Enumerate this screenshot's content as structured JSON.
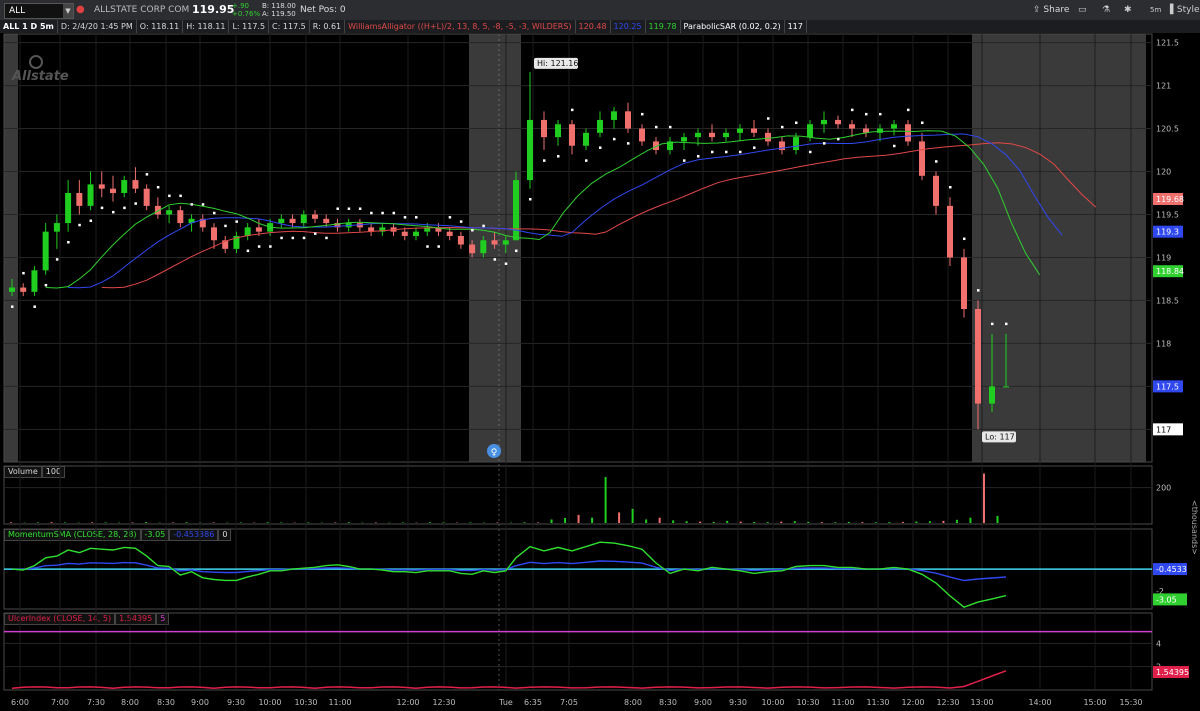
{
  "topbar": {
    "symbol": "ALL",
    "company": "ALLSTATE CORP COM",
    "last": "119.95",
    "change": "+.90",
    "change_pct": "+0.76%",
    "bid": "B: 118.00",
    "ask": "A: 119.50",
    "net_pos": "Net Pos: 0",
    "share_label": "Share",
    "aggregation_label": "5m",
    "style_label": "Style"
  },
  "header": {
    "agg": "ALL 1 D 5m",
    "date": "D: 2/4/20 1:45 PM",
    "open": "O: 118.11",
    "high": "H: 118.11",
    "low": "L: 117.5",
    "close": "C: 117.5",
    "range": "R: 0.61",
    "alligator": "WilliamsAlligator ((H+L)/2, 13, 8, 5, -8, -5, -3, WILDERS)",
    "alligator_jaw": "120.48",
    "alligator_teeth": "120.25",
    "alligator_lips": "119.78",
    "sar": "ParabolicSAR (0.02, 0.2)",
    "sar_value": "117"
  },
  "watermark": "Allstate",
  "colors": {
    "up": "#1fce1f",
    "down": "#f0706e",
    "accent": "#4a90e2",
    "jaw": "#e04848",
    "teeth": "#3048f0",
    "lips": "#30d030",
    "volume_up": "#1fce1f",
    "volume_down": "#f0706e",
    "momentum": "#30e030",
    "momentum_sma": "#3048f0",
    "zero_line": "#40d8f0",
    "ulcer": "#e0204a",
    "ulcer_threshold": "#d040d0"
  },
  "chart_data": [
    {
      "type": "candlestick",
      "panel": "price",
      "ylim": [
        116.62,
        121.6
      ],
      "y_ticks": [
        "121.5",
        "121",
        "120.5",
        "120",
        "119.5",
        "119",
        "118.5",
        "118",
        "117.5",
        "117"
      ],
      "ohlc": [
        [
          118.6,
          118.75,
          118.55,
          118.65
        ],
        [
          118.65,
          118.7,
          118.55,
          118.6
        ],
        [
          118.6,
          118.9,
          118.55,
          118.85
        ],
        [
          118.85,
          119.4,
          118.8,
          119.3
        ],
        [
          119.3,
          119.5,
          119.1,
          119.4
        ],
        [
          119.4,
          119.9,
          119.3,
          119.75
        ],
        [
          119.75,
          119.9,
          119.5,
          119.6
        ],
        [
          119.6,
          120.0,
          119.55,
          119.85
        ],
        [
          119.85,
          120.0,
          119.7,
          119.8
        ],
        [
          119.8,
          119.95,
          119.65,
          119.75
        ],
        [
          119.75,
          119.95,
          119.7,
          119.9
        ],
        [
          119.9,
          120.05,
          119.75,
          119.8
        ],
        [
          119.8,
          119.85,
          119.55,
          119.6
        ],
        [
          119.6,
          119.7,
          119.45,
          119.5
        ],
        [
          119.5,
          119.6,
          119.4,
          119.55
        ],
        [
          119.55,
          119.6,
          119.35,
          119.4
        ],
        [
          119.4,
          119.5,
          119.3,
          119.45
        ],
        [
          119.45,
          119.5,
          119.3,
          119.35
        ],
        [
          119.35,
          119.4,
          119.1,
          119.2
        ],
        [
          119.2,
          119.25,
          119.05,
          119.1
        ],
        [
          119.1,
          119.3,
          119.05,
          119.25
        ],
        [
          119.25,
          119.4,
          119.2,
          119.35
        ],
        [
          119.35,
          119.45,
          119.25,
          119.3
        ],
        [
          119.3,
          119.45,
          119.25,
          119.4
        ],
        [
          119.4,
          119.5,
          119.35,
          119.45
        ],
        [
          119.45,
          119.5,
          119.35,
          119.4
        ],
        [
          119.4,
          119.55,
          119.35,
          119.5
        ],
        [
          119.5,
          119.55,
          119.4,
          119.45
        ],
        [
          119.45,
          119.5,
          119.35,
          119.4
        ],
        [
          119.4,
          119.45,
          119.3,
          119.35
        ],
        [
          119.35,
          119.45,
          119.3,
          119.4
        ],
        [
          119.4,
          119.45,
          119.3,
          119.35
        ],
        [
          119.35,
          119.4,
          119.25,
          119.3
        ],
        [
          119.3,
          119.4,
          119.25,
          119.35
        ],
        [
          119.35,
          119.4,
          119.25,
          119.3
        ],
        [
          119.3,
          119.35,
          119.2,
          119.25
        ],
        [
          119.25,
          119.35,
          119.2,
          119.3
        ],
        [
          119.3,
          119.4,
          119.25,
          119.35
        ],
        [
          119.35,
          119.4,
          119.25,
          119.3
        ],
        [
          119.3,
          119.35,
          119.2,
          119.25
        ],
        [
          119.25,
          119.3,
          119.1,
          119.15
        ],
        [
          119.15,
          119.2,
          119.0,
          119.05
        ],
        [
          119.05,
          119.25,
          119.0,
          119.2
        ],
        [
          119.2,
          119.3,
          119.1,
          119.15
        ],
        [
          119.15,
          119.25,
          119.05,
          119.2
        ],
        [
          119.2,
          120.0,
          119.2,
          119.9
        ],
        [
          119.9,
          121.16,
          119.8,
          120.6
        ],
        [
          120.6,
          120.7,
          120.25,
          120.4
        ],
        [
          120.4,
          120.6,
          120.3,
          120.55
        ],
        [
          120.55,
          120.6,
          120.2,
          120.3
        ],
        [
          120.3,
          120.5,
          120.25,
          120.45
        ],
        [
          120.45,
          120.7,
          120.4,
          120.6
        ],
        [
          120.6,
          120.75,
          120.5,
          120.7
        ],
        [
          120.7,
          120.8,
          120.45,
          120.5
        ],
        [
          120.5,
          120.55,
          120.3,
          120.35
        ],
        [
          120.35,
          120.4,
          120.2,
          120.25
        ],
        [
          120.25,
          120.4,
          120.2,
          120.35
        ],
        [
          120.35,
          120.45,
          120.25,
          120.4
        ],
        [
          120.4,
          120.5,
          120.3,
          120.45
        ],
        [
          120.45,
          120.55,
          120.35,
          120.4
        ],
        [
          120.4,
          120.5,
          120.35,
          120.45
        ],
        [
          120.45,
          120.55,
          120.35,
          120.5
        ],
        [
          120.5,
          120.6,
          120.4,
          120.45
        ],
        [
          120.45,
          120.5,
          120.3,
          120.35
        ],
        [
          120.35,
          120.4,
          120.2,
          120.25
        ],
        [
          120.25,
          120.45,
          120.2,
          120.4
        ],
        [
          120.4,
          120.6,
          120.35,
          120.55
        ],
        [
          120.55,
          120.7,
          120.45,
          120.6
        ],
        [
          120.6,
          120.65,
          120.5,
          120.55
        ],
        [
          120.55,
          120.6,
          120.4,
          120.5
        ],
        [
          120.5,
          120.55,
          120.4,
          120.45
        ],
        [
          120.45,
          120.55,
          120.35,
          120.5
        ],
        [
          120.5,
          120.6,
          120.42,
          120.55
        ],
        [
          120.55,
          120.6,
          120.3,
          120.35
        ],
        [
          120.35,
          120.45,
          119.9,
          119.95
        ],
        [
          119.95,
          120.0,
          119.5,
          119.6
        ],
        [
          119.6,
          119.7,
          118.9,
          119.0
        ],
        [
          119.0,
          119.1,
          118.3,
          118.4
        ],
        [
          118.4,
          118.5,
          117.0,
          117.3
        ],
        [
          117.3,
          118.11,
          117.2,
          117.5
        ],
        [
          117.5,
          118.11,
          117.5,
          117.5
        ]
      ],
      "series": [
        {
          "name": "WilliamsAlligator Jaw",
          "value": 120.48
        },
        {
          "name": "WilliamsAlligator Teeth",
          "value": 120.25
        },
        {
          "name": "WilliamsAlligator Lips",
          "value": 119.78
        },
        {
          "name": "ParabolicSAR",
          "value": 117
        }
      ],
      "annotations": [
        {
          "text": "Hi: 121.16",
          "value": 121.16
        },
        {
          "text": "Lo: 117",
          "value": 117
        }
      ],
      "last_labels": [
        {
          "text": "119.68",
          "value": 119.68,
          "color": "#f0706e"
        },
        {
          "text": "119.3",
          "value": 119.3,
          "color": "#3048f0"
        },
        {
          "text": "118.84",
          "value": 118.84,
          "color": "#30d030"
        },
        {
          "text": "117.5",
          "value": 117.5,
          "color": "#3048f0"
        },
        {
          "text": "117",
          "value": 117,
          "color": "#ffffff"
        }
      ]
    },
    {
      "type": "bar",
      "panel": "volume",
      "title": "Volume",
      "title_value": "100",
      "y_ticks": [
        "200"
      ],
      "unit": "<thousands>",
      "values": [
        4,
        2,
        3,
        5,
        3,
        2,
        4,
        3,
        2,
        3,
        5,
        2,
        3,
        4,
        2,
        3,
        2,
        3,
        2,
        4,
        3,
        2,
        3,
        2,
        3,
        4,
        2,
        3,
        2,
        3,
        2,
        4,
        3,
        2,
        3,
        2,
        3,
        2,
        4,
        3,
        20,
        28,
        46,
        30,
        260,
        60,
        80,
        20,
        30,
        15,
        10,
        8,
        6,
        12,
        8,
        6,
        5,
        8,
        10,
        6,
        5,
        4,
        6,
        5,
        4,
        5,
        6,
        8,
        10,
        12,
        18,
        30,
        280,
        40
      ]
    },
    {
      "type": "line",
      "panel": "momentum",
      "title": "MomentumSMA (CLOSE, 28, 28)",
      "values_shown": [
        "-3.05",
        "-0.453386",
        "0"
      ],
      "y_ticks": [
        "-2"
      ],
      "last_labels": [
        {
          "text": "-0.4533",
          "color": "#3048f0"
        },
        {
          "text": "-3.05",
          "color": "#30d030"
        }
      ]
    },
    {
      "type": "line",
      "panel": "ulcer",
      "title": "UlcerIndex (CLOSE, 14, 5)",
      "values_shown": [
        "1.54395",
        "5"
      ],
      "y_ticks": [
        "4",
        "2"
      ],
      "last_labels": [
        {
          "text": "1.54395",
          "color": "#e0204a"
        }
      ]
    }
  ],
  "time_axis": [
    "6:00",
    "7:00",
    "7:30",
    "8:00",
    "8:30",
    "9:00",
    "9:30",
    "10:00",
    "10:30",
    "11:00",
    "12:00",
    "12:30",
    "Tue",
    "6:35",
    "7:05",
    "8:00",
    "8:30",
    "9:00",
    "9:30",
    "10:00",
    "10:30",
    "11:00",
    "11:30",
    "12:00",
    "12:30",
    "13:00",
    "14:00",
    "15:00",
    "15:30"
  ]
}
